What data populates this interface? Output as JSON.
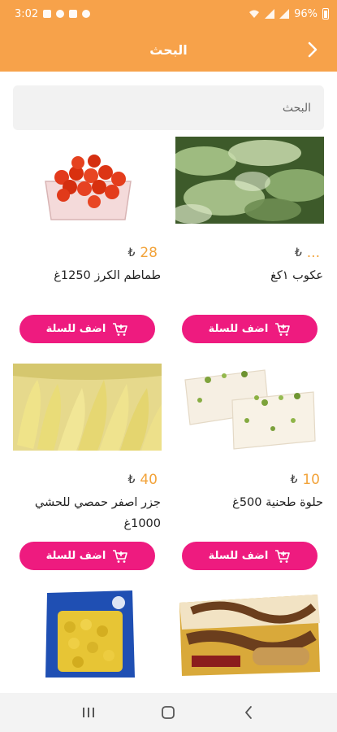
{
  "status_bar": {
    "time": "3:02",
    "battery": "96%",
    "icons_left": [
      "gallery-icon",
      "whatsapp-icon",
      "image-icon",
      "wifi-call-icon"
    ],
    "icons_right": [
      "wifi-icon",
      "signal-icon",
      "signal-icon",
      "battery-icon"
    ]
  },
  "app_bar": {
    "title": "البحث",
    "back_icon": "chevron-right-icon"
  },
  "search": {
    "placeholder": "البحث",
    "value": ""
  },
  "colors": {
    "accent": "#f7a24a",
    "button": "#ee1b7f",
    "price": "#f2a33a"
  },
  "products": [
    {
      "id": "p1",
      "price": "...",
      "currency": "₺",
      "name": "عكوب ١كغ",
      "add_label": "اضف للسلة",
      "image_icon": "akkoub-photo"
    },
    {
      "id": "p2",
      "price": "28",
      "currency": "₺",
      "name": "طماطم الكرز 1250غ",
      "add_label": "اضف للسلة",
      "image_icon": "cherry-tomato-photo"
    },
    {
      "id": "p3",
      "price": "10",
      "currency": "₺",
      "name": "حلوة طحنية 500غ",
      "add_label": "اضف للسلة",
      "image_icon": "halva-photo"
    },
    {
      "id": "p4",
      "price": "40",
      "currency": "₺",
      "name": "جزر اصفر حمصي للحشي 1000غ",
      "add_label": "اضف للسلة",
      "image_icon": "yellow-carrot-photo"
    },
    {
      "id": "p5",
      "image_icon": "wafer-box-photo"
    },
    {
      "id": "p6",
      "image_icon": "pasta-bag-photo"
    }
  ],
  "nav_bar": {
    "icons": [
      "recents-icon",
      "home-icon",
      "back-icon"
    ]
  }
}
